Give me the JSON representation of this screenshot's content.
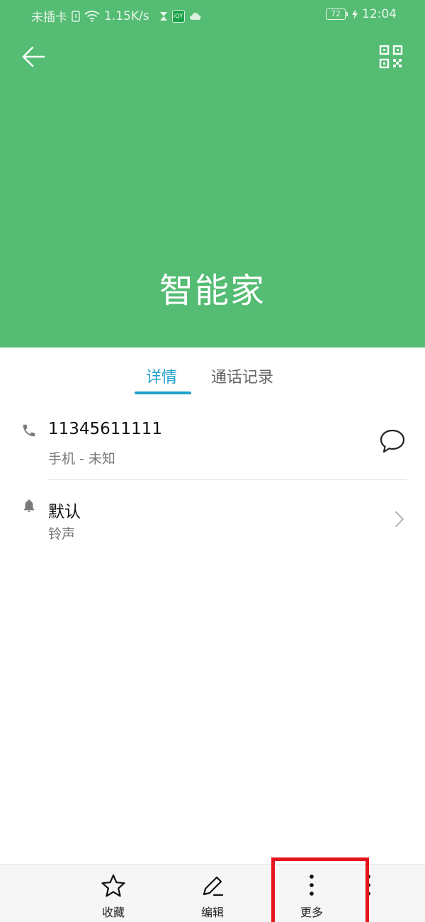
{
  "status_bar": {
    "carrier": "未插卡",
    "speed": "1.15K/s",
    "battery": "72",
    "time": "12:04",
    "icons": [
      "sim-icon",
      "wifi-icon",
      "hourglass-icon",
      "iqiyi-icon",
      "cloud-icon",
      "charging-icon"
    ],
    "badge_text": "iQY"
  },
  "header": {
    "background": "#54bc73",
    "contact_name": "智能家",
    "back_icon": "arrow-left-icon",
    "qr_icon": "qr-code-icon"
  },
  "tabs": [
    {
      "label": "详情",
      "active": true
    },
    {
      "label": "通话记录",
      "active": false
    }
  ],
  "accent_color": "#1fa0c9",
  "details": {
    "phone": {
      "number": "11345611111",
      "type": "手机 - 未知",
      "icon": "phone-icon",
      "action_icon": "message-icon"
    },
    "ringtone": {
      "value": "默认",
      "label": "铃声",
      "icon": "bell-icon",
      "action_icon": "chevron-right-icon"
    }
  },
  "bottom_bar": {
    "favorite": "收藏",
    "edit": "编辑",
    "more": "更多"
  },
  "highlight_color": "#e8141b"
}
